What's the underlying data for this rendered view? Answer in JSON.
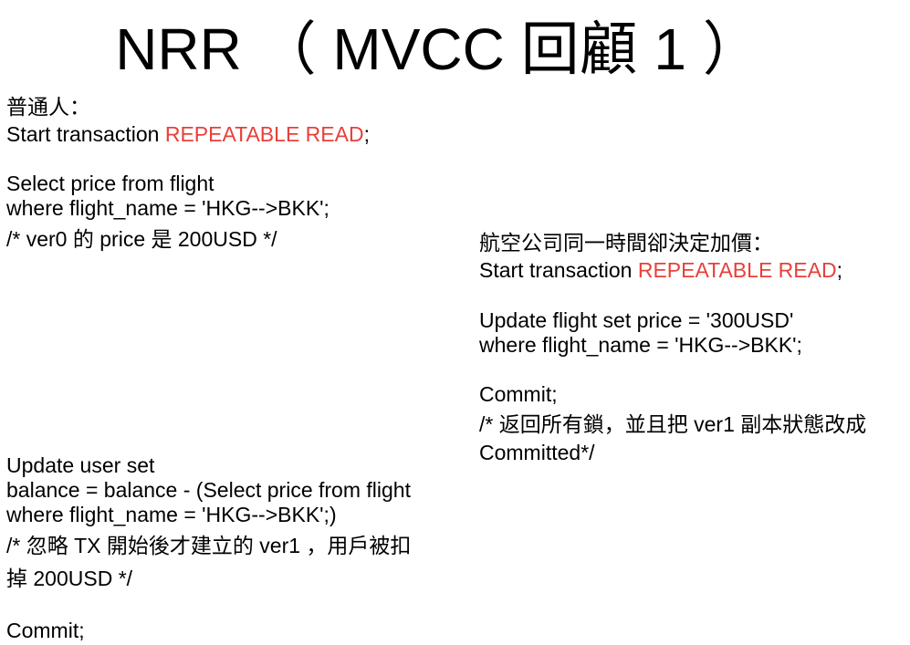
{
  "title": "NRR （ MVCC 回顧 1 ）",
  "accent_color": "#e8403a",
  "left": {
    "heading": "普通人：",
    "start_prefix": "Start transaction ",
    "start_mode": "REPEATABLE READ",
    "start_suffix": ";",
    "select_1": "Select price from flight",
    "select_2": "where flight_name = 'HKG-->BKK';",
    "select_comment": "/* ver0 的 price 是 200USD */",
    "update_1": "Update user set",
    "update_2": "balance = balance - (Select price from flight",
    "update_3": "where flight_name = 'HKG-->BKK';)",
    "update_comment_1": "/*  忽略 TX 開始後才建立的 ver1 ，用戶被扣",
    "update_comment_2": "掉 200USD */",
    "commit": "Commit;"
  },
  "right": {
    "heading": "航空公司同一時間卻決定加價：",
    "start_prefix": "Start transaction ",
    "start_mode": "REPEATABLE READ",
    "start_suffix": ";",
    "update_1": "Update flight set price = '300USD'",
    "update_2": "where flight_name = 'HKG-->BKK';",
    "commit": "Commit;",
    "commit_comment_1": "/* 返回所有鎖，並且把 ver1 副本狀態改成",
    "commit_comment_2": "Committed*/"
  }
}
